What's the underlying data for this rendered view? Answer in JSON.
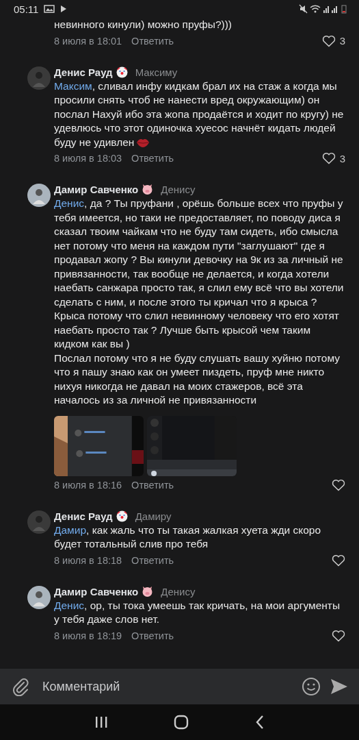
{
  "status_bar": {
    "time": "05:11"
  },
  "comments": [
    {
      "text": "невинного кинули) можно пруфы?)))",
      "date": "8 июля в 18:01",
      "reply": "Ответить",
      "likes": "3",
      "liked": false
    },
    {
      "author": "Денис Рауд",
      "badge": {
        "kind": "clown"
      },
      "reply_to": "Максиму",
      "mention": "Максим",
      "text": ", сливал инфу кидкам брал их на стаж а когда мы просили снять чтоб не нанести вред окружающим) он послал Нахуй ибо эта жопа продаётся и ходит по кругу) не удевлюсь что этот одиночка хуесос начнёт кидать людей буду не удивлен",
      "trailing_emoji": {
        "kind": "lips"
      },
      "date": "8 июля в 18:03",
      "reply": "Ответить",
      "likes": "3",
      "liked": false
    },
    {
      "author": "Дамир Савченко",
      "badge": {
        "kind": "pig"
      },
      "reply_to": "Денису",
      "mention": "Денис",
      "text": ", да ? Ты пруфани , орёшь больше  всех что пруфы у тебя имеется,  но таки не предоставляет, по поводу диса я сказал твоим чайкам что  не  буду там сидеть, ибо смысла нет потому что меня на каждом пути \"заглушают\" где я продавал жопу ? Вы кинули девочку на 9к из за личный не привязанности,  так вообще не делается,  и когда хотели наебать санжара просто так, я слил ему всё что вы хотели сделать с ним, и после этого ты кричал что я крыса ? Крыса потому что слил невинному человеку что его хотят наебать просто так ? Лучше быть крысой чем таким кидком как вы )\nПослал потому что я не буду слушать вашу хуйню потому что  я пашу знаю как он умеет пиздеть, пруф мне никто нихуя никогда не давал на моих стажеров, всё эта началось из за личной не привязанности",
      "date": "8 июля в 18:16",
      "reply": "Ответить",
      "liked": false
    },
    {
      "author": "Денис Рауд",
      "badge": {
        "kind": "clown"
      },
      "reply_to": "Дамиру",
      "mention": "Дамир",
      "text": ", как жаль что ты такая жалкая хуета жди скоро будет тотальный слив про тебя",
      "date": "8 июля в 18:18",
      "reply": "Ответить",
      "liked": false
    },
    {
      "author": "Дамир Савченко",
      "badge": {
        "kind": "pig"
      },
      "reply_to": "Денису",
      "mention": "Денис",
      "text": ", ор, ты тока умеешь так кричать, на мои аргументы у тебя даже слов нет.",
      "date": "8 июля в 18:19",
      "reply": "Ответить",
      "liked": false
    }
  ],
  "composer": {
    "placeholder": "Комментарий"
  }
}
